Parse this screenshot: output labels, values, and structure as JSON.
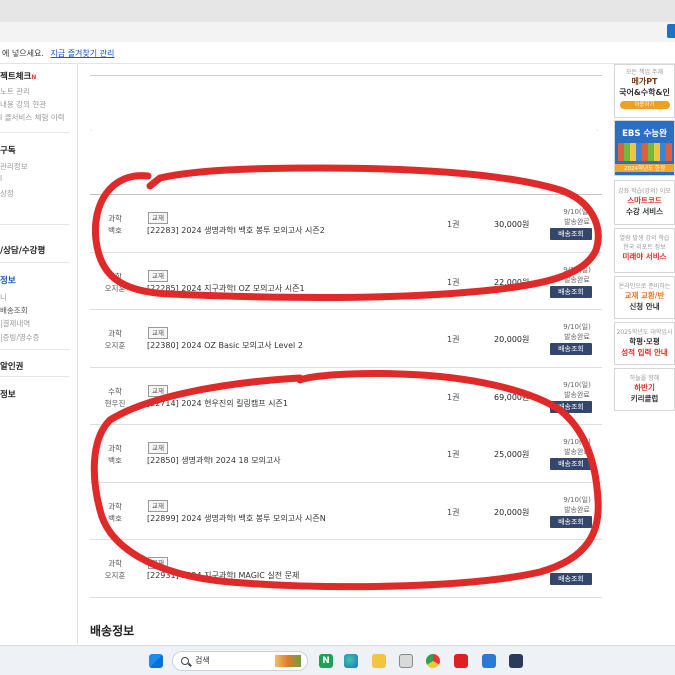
{
  "browser": {
    "favbar_text": "에 넣으세요.",
    "favbar_link": "지금 즐겨찾기 관리"
  },
  "lnb": {
    "project_check": "젝트체크",
    "new_mark": "N",
    "sub1": "노트 관리",
    "sub2": "내용 강의 현관",
    "sub3": "I 클서비스 체험 이력",
    "subscribe": "구독",
    "sub4": "관리정보",
    "sub5": "l",
    "sub6": "상정",
    "counsel": "/상담/수강평",
    "order_info": "정보",
    "order_sub1": "니",
    "order_sub2": "배송조회",
    "order_sub3": "|결제내역",
    "order_sub4": "|증빙/영수증",
    "alarm": "알인권",
    "last": "정보"
  },
  "orders": [
    {
      "subject": "과학\n백호",
      "badge": "교재",
      "title": "[22283] 2024 생명과학I 백호 봉투 모의고사 시즌2",
      "qty": "1권",
      "price": "30,000원",
      "date": "9/10(일)\n발송완료",
      "btn": "배송조회"
    },
    {
      "subject": "과학\n오지훈",
      "badge": "교재",
      "title": "[22285] 2024 지구과학I OZ 모의고사 시즌1",
      "qty": "1권",
      "price": "22,000원",
      "date": "9/10(일)\n발송완료",
      "btn": "배송조회"
    },
    {
      "subject": "과학\n오지훈",
      "badge": "교재",
      "title": "[22380] 2024 OZ Basic 모의고사 Level 2",
      "qty": "1권",
      "price": "20,000원",
      "date": "9/10(일)\n발송완료",
      "btn": "배송조회"
    },
    {
      "subject": "수학\n현우진",
      "badge": "교재",
      "title": "[22714] 2024 현우진의 킬링캠프 시즌1",
      "qty": "1권",
      "price": "69,000원",
      "date": "9/10(일)\n발송완료",
      "btn": "배송조회"
    },
    {
      "subject": "과학\n백호",
      "badge": "교재",
      "title": "[22850] 생명과학I 2024 18 모의고사",
      "qty": "1권",
      "price": "25,000원",
      "date": "9/10(일)\n발송완료",
      "btn": "배송조회"
    },
    {
      "subject": "과학\n백호",
      "badge": "교재",
      "title": "[22899] 2024 생명과학I 백호 봉투 모의고사 시즌N",
      "qty": "1권",
      "price": "20,000원",
      "date": "9/10(일)\n발송완료",
      "btn": "배송조회"
    },
    {
      "subject": "과학\n오지훈",
      "badge": "교재",
      "title": "[22931] 2024 지구과학I MAGIC 실전 문제",
      "qty": "",
      "price": "",
      "date": "",
      "btn": "배송조회"
    }
  ],
  "section_title": "배송정보",
  "right_banners": [
    {
      "t1": "모든 책임 주재",
      "t2": "메가PT",
      "t3": "국어&수학&인",
      "t4": "이용하기"
    },
    {
      "t1": "",
      "t2": "EBS 수능완",
      "t3": "",
      "t4": "2024학년도 한정"
    },
    {
      "t1": "강좌 학습(강의) 이모",
      "t2": "스마트코드",
      "t3": "수강 서비스"
    },
    {
      "t1": "열람 발생 강의 학습",
      "t2": "한국 리포트 정보",
      "t3": "미래야 서비스"
    },
    {
      "t1": "온라인으로 준비하는",
      "t2": "교재 교환/반",
      "t3": "신청 안내"
    },
    {
      "t1": "2025학년도 대학입시",
      "t2": "학평·모평",
      "t3": "성적 입력 안내"
    },
    {
      "t1": "하늘을 향해",
      "t2": "하반기",
      "t3": "키리클럽"
    }
  ],
  "taskbar": {
    "search_placeholder": "검색"
  },
  "colors": {
    "button_navy": "#34466b",
    "annotation_red": "#e02a2a",
    "link_blue": "#1a55c0"
  }
}
